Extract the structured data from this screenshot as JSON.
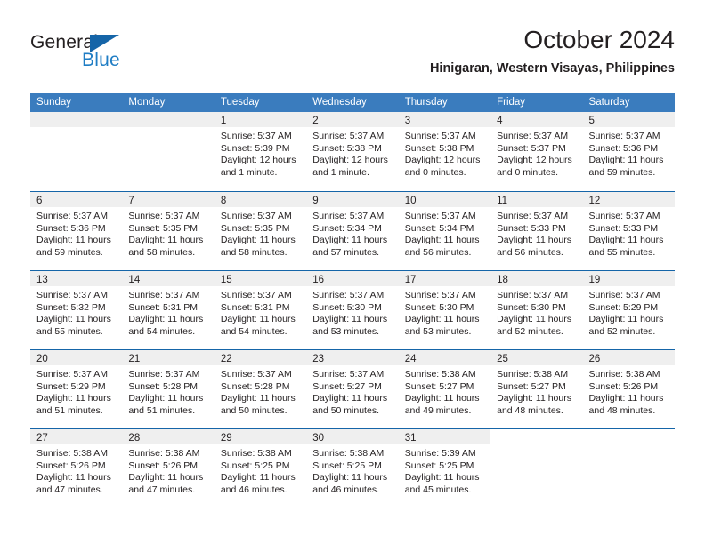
{
  "brand": {
    "name_top": "General",
    "name_bottom": "Blue",
    "triangle_color": "#1565a8",
    "blue_color": "#1f7dc4"
  },
  "header": {
    "month_title": "October 2024",
    "location": "Hinigaran, Western Visayas, Philippines"
  },
  "theme": {
    "header_blue": "#3a7cbe",
    "rule_blue": "#1565a8",
    "day_band_gray": "#efefef",
    "text": "#231f20"
  },
  "calendar": {
    "weekdays": [
      "Sunday",
      "Monday",
      "Tuesday",
      "Wednesday",
      "Thursday",
      "Friday",
      "Saturday"
    ],
    "labels": {
      "sunrise": "Sunrise:",
      "sunset": "Sunset:",
      "daylight": "Daylight:"
    },
    "weeks": [
      [
        {
          "day": "",
          "empty": true
        },
        {
          "day": "",
          "empty": true
        },
        {
          "day": "1",
          "sunrise": "Sunrise: 5:37 AM",
          "sunset": "Sunset: 5:39 PM",
          "daylight_1": "Daylight: 12 hours",
          "daylight_2": "and 1 minute."
        },
        {
          "day": "2",
          "sunrise": "Sunrise: 5:37 AM",
          "sunset": "Sunset: 5:38 PM",
          "daylight_1": "Daylight: 12 hours",
          "daylight_2": "and 1 minute."
        },
        {
          "day": "3",
          "sunrise": "Sunrise: 5:37 AM",
          "sunset": "Sunset: 5:38 PM",
          "daylight_1": "Daylight: 12 hours",
          "daylight_2": "and 0 minutes."
        },
        {
          "day": "4",
          "sunrise": "Sunrise: 5:37 AM",
          "sunset": "Sunset: 5:37 PM",
          "daylight_1": "Daylight: 12 hours",
          "daylight_2": "and 0 minutes."
        },
        {
          "day": "5",
          "sunrise": "Sunrise: 5:37 AM",
          "sunset": "Sunset: 5:36 PM",
          "daylight_1": "Daylight: 11 hours",
          "daylight_2": "and 59 minutes."
        }
      ],
      [
        {
          "day": "6",
          "sunrise": "Sunrise: 5:37 AM",
          "sunset": "Sunset: 5:36 PM",
          "daylight_1": "Daylight: 11 hours",
          "daylight_2": "and 59 minutes."
        },
        {
          "day": "7",
          "sunrise": "Sunrise: 5:37 AM",
          "sunset": "Sunset: 5:35 PM",
          "daylight_1": "Daylight: 11 hours",
          "daylight_2": "and 58 minutes."
        },
        {
          "day": "8",
          "sunrise": "Sunrise: 5:37 AM",
          "sunset": "Sunset: 5:35 PM",
          "daylight_1": "Daylight: 11 hours",
          "daylight_2": "and 58 minutes."
        },
        {
          "day": "9",
          "sunrise": "Sunrise: 5:37 AM",
          "sunset": "Sunset: 5:34 PM",
          "daylight_1": "Daylight: 11 hours",
          "daylight_2": "and 57 minutes."
        },
        {
          "day": "10",
          "sunrise": "Sunrise: 5:37 AM",
          "sunset": "Sunset: 5:34 PM",
          "daylight_1": "Daylight: 11 hours",
          "daylight_2": "and 56 minutes."
        },
        {
          "day": "11",
          "sunrise": "Sunrise: 5:37 AM",
          "sunset": "Sunset: 5:33 PM",
          "daylight_1": "Daylight: 11 hours",
          "daylight_2": "and 56 minutes."
        },
        {
          "day": "12",
          "sunrise": "Sunrise: 5:37 AM",
          "sunset": "Sunset: 5:33 PM",
          "daylight_1": "Daylight: 11 hours",
          "daylight_2": "and 55 minutes."
        }
      ],
      [
        {
          "day": "13",
          "sunrise": "Sunrise: 5:37 AM",
          "sunset": "Sunset: 5:32 PM",
          "daylight_1": "Daylight: 11 hours",
          "daylight_2": "and 55 minutes."
        },
        {
          "day": "14",
          "sunrise": "Sunrise: 5:37 AM",
          "sunset": "Sunset: 5:31 PM",
          "daylight_1": "Daylight: 11 hours",
          "daylight_2": "and 54 minutes."
        },
        {
          "day": "15",
          "sunrise": "Sunrise: 5:37 AM",
          "sunset": "Sunset: 5:31 PM",
          "daylight_1": "Daylight: 11 hours",
          "daylight_2": "and 54 minutes."
        },
        {
          "day": "16",
          "sunrise": "Sunrise: 5:37 AM",
          "sunset": "Sunset: 5:30 PM",
          "daylight_1": "Daylight: 11 hours",
          "daylight_2": "and 53 minutes."
        },
        {
          "day": "17",
          "sunrise": "Sunrise: 5:37 AM",
          "sunset": "Sunset: 5:30 PM",
          "daylight_1": "Daylight: 11 hours",
          "daylight_2": "and 53 minutes."
        },
        {
          "day": "18",
          "sunrise": "Sunrise: 5:37 AM",
          "sunset": "Sunset: 5:30 PM",
          "daylight_1": "Daylight: 11 hours",
          "daylight_2": "and 52 minutes."
        },
        {
          "day": "19",
          "sunrise": "Sunrise: 5:37 AM",
          "sunset": "Sunset: 5:29 PM",
          "daylight_1": "Daylight: 11 hours",
          "daylight_2": "and 52 minutes."
        }
      ],
      [
        {
          "day": "20",
          "sunrise": "Sunrise: 5:37 AM",
          "sunset": "Sunset: 5:29 PM",
          "daylight_1": "Daylight: 11 hours",
          "daylight_2": "and 51 minutes."
        },
        {
          "day": "21",
          "sunrise": "Sunrise: 5:37 AM",
          "sunset": "Sunset: 5:28 PM",
          "daylight_1": "Daylight: 11 hours",
          "daylight_2": "and 51 minutes."
        },
        {
          "day": "22",
          "sunrise": "Sunrise: 5:37 AM",
          "sunset": "Sunset: 5:28 PM",
          "daylight_1": "Daylight: 11 hours",
          "daylight_2": "and 50 minutes."
        },
        {
          "day": "23",
          "sunrise": "Sunrise: 5:37 AM",
          "sunset": "Sunset: 5:27 PM",
          "daylight_1": "Daylight: 11 hours",
          "daylight_2": "and 50 minutes."
        },
        {
          "day": "24",
          "sunrise": "Sunrise: 5:38 AM",
          "sunset": "Sunset: 5:27 PM",
          "daylight_1": "Daylight: 11 hours",
          "daylight_2": "and 49 minutes."
        },
        {
          "day": "25",
          "sunrise": "Sunrise: 5:38 AM",
          "sunset": "Sunset: 5:27 PM",
          "daylight_1": "Daylight: 11 hours",
          "daylight_2": "and 48 minutes."
        },
        {
          "day": "26",
          "sunrise": "Sunrise: 5:38 AM",
          "sunset": "Sunset: 5:26 PM",
          "daylight_1": "Daylight: 11 hours",
          "daylight_2": "and 48 minutes."
        }
      ],
      [
        {
          "day": "27",
          "sunrise": "Sunrise: 5:38 AM",
          "sunset": "Sunset: 5:26 PM",
          "daylight_1": "Daylight: 11 hours",
          "daylight_2": "and 47 minutes."
        },
        {
          "day": "28",
          "sunrise": "Sunrise: 5:38 AM",
          "sunset": "Sunset: 5:26 PM",
          "daylight_1": "Daylight: 11 hours",
          "daylight_2": "and 47 minutes."
        },
        {
          "day": "29",
          "sunrise": "Sunrise: 5:38 AM",
          "sunset": "Sunset: 5:25 PM",
          "daylight_1": "Daylight: 11 hours",
          "daylight_2": "and 46 minutes."
        },
        {
          "day": "30",
          "sunrise": "Sunrise: 5:38 AM",
          "sunset": "Sunset: 5:25 PM",
          "daylight_1": "Daylight: 11 hours",
          "daylight_2": "and 46 minutes."
        },
        {
          "day": "31",
          "sunrise": "Sunrise: 5:39 AM",
          "sunset": "Sunset: 5:25 PM",
          "daylight_1": "Daylight: 11 hours",
          "daylight_2": "and 45 minutes."
        },
        {
          "day": "",
          "empty": true,
          "blank": true
        },
        {
          "day": "",
          "empty": true,
          "blank": true
        }
      ]
    ]
  }
}
